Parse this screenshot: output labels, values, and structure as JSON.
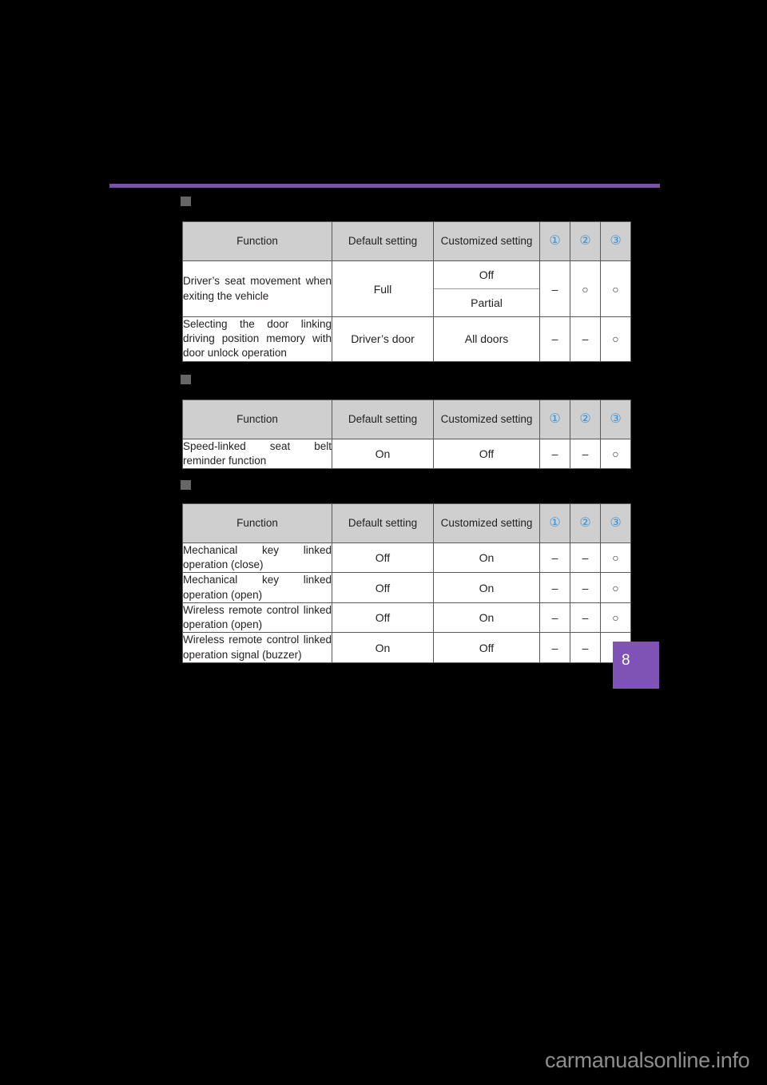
{
  "page": {
    "background_color": "#000000",
    "rule_color": "#7c4fa8",
    "marker_color": "#666666",
    "accent_color": "#3c8fd0",
    "tab_color": "#7f52b5",
    "tab_number": "8",
    "watermark": "carmanualsonline.info"
  },
  "columns": {
    "function": "Function",
    "default_setting": "Default setting",
    "customized_setting": "Customized setting",
    "mark1": "①",
    "mark2": "②",
    "mark3": "③"
  },
  "glyphs": {
    "circle": "○",
    "dash": "–"
  },
  "tables": [
    {
      "id": "seat-and-door-linked-memory",
      "rows": [
        {
          "function": "Driver’s seat movement when exiting the vehicle",
          "default": "Full",
          "customized": [
            "Off",
            "Partial"
          ],
          "mark1": "–",
          "mark2": "○",
          "mark3": "○"
        },
        {
          "function": "Selecting the door linking driving position memory with door unlock operation",
          "default": "Driver’s door",
          "customized": [
            "All doors"
          ],
          "mark1": "–",
          "mark2": "–",
          "mark3": "○"
        }
      ]
    },
    {
      "id": "seat-belt-reminder",
      "rows": [
        {
          "function": "Speed-linked seat belt reminder function",
          "default": "On",
          "customized": [
            "Off"
          ],
          "mark1": "–",
          "mark2": "–",
          "mark3": "○"
        }
      ]
    },
    {
      "id": "key-linked-operation",
      "rows": [
        {
          "function": "Mechanical key linked operation (close)",
          "default": "Off",
          "customized": [
            "On"
          ],
          "mark1": "–",
          "mark2": "–",
          "mark3": "○"
        },
        {
          "function": "Mechanical key linked operation (open)",
          "default": "Off",
          "customized": [
            "On"
          ],
          "mark1": "–",
          "mark2": "–",
          "mark3": "○"
        },
        {
          "function": "Wireless remote control linked operation (open)",
          "default": "Off",
          "customized": [
            "On"
          ],
          "mark1": "–",
          "mark2": "–",
          "mark3": "○"
        },
        {
          "function": "Wireless remote control linked operation signal (buzzer)",
          "default": "On",
          "customized": [
            "Off"
          ],
          "mark1": "–",
          "mark2": "–",
          "mark3": "○"
        }
      ]
    }
  ]
}
